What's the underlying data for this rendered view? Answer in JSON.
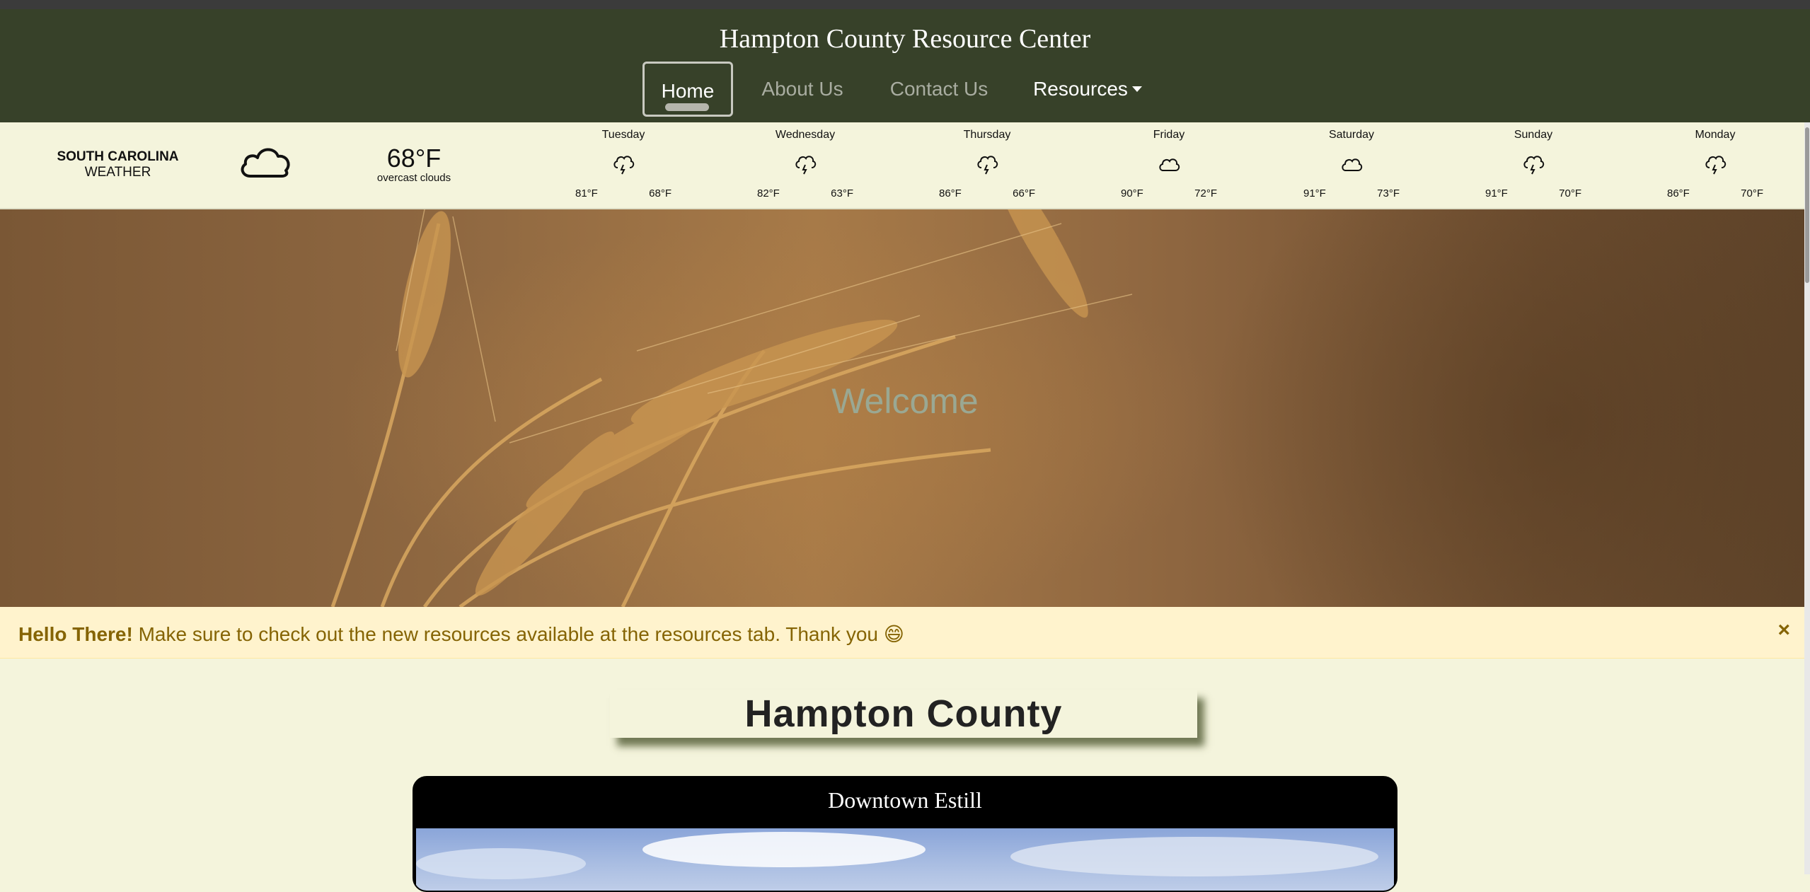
{
  "site": {
    "title": "Hampton County Resource Center"
  },
  "nav": {
    "items": [
      {
        "label": "Home"
      },
      {
        "label": "About Us"
      },
      {
        "label": "Contact Us"
      },
      {
        "label": "Resources"
      }
    ]
  },
  "weather": {
    "region_state": "SOUTH CAROLINA",
    "region_label": "WEATHER",
    "current_temp": "68°F",
    "current_desc": "overcast clouds",
    "current_icon": "cloud-icon",
    "days": [
      {
        "name": "Tuesday",
        "hi": "81°F",
        "lo": "68°F",
        "icon": "thunder-rain-icon"
      },
      {
        "name": "Wednesday",
        "hi": "82°F",
        "lo": "63°F",
        "icon": "thunder-rain-icon"
      },
      {
        "name": "Thursday",
        "hi": "86°F",
        "lo": "66°F",
        "icon": "thunder-rain-icon"
      },
      {
        "name": "Friday",
        "hi": "90°F",
        "lo": "72°F",
        "icon": "cloud-icon"
      },
      {
        "name": "Saturday",
        "hi": "91°F",
        "lo": "73°F",
        "icon": "cloud-icon"
      },
      {
        "name": "Sunday",
        "hi": "91°F",
        "lo": "70°F",
        "icon": "thunder-rain-icon"
      },
      {
        "name": "Monday",
        "hi": "86°F",
        "lo": "70°F",
        "icon": "thunder-rain-icon"
      }
    ]
  },
  "hero": {
    "title": "Welcome"
  },
  "alert": {
    "strong": "Hello There!",
    "message": " Make sure to check out the new resources available at the resources tab. Thank you",
    "emoji": "😄",
    "close": "×"
  },
  "county": {
    "title": "Hampton County"
  },
  "card": {
    "title": "Downtown Estill"
  },
  "colors": {
    "navbar": "#374129",
    "page_background": "#f4f4dc",
    "alert_background": "#fff3cd",
    "alert_text": "#856404"
  }
}
